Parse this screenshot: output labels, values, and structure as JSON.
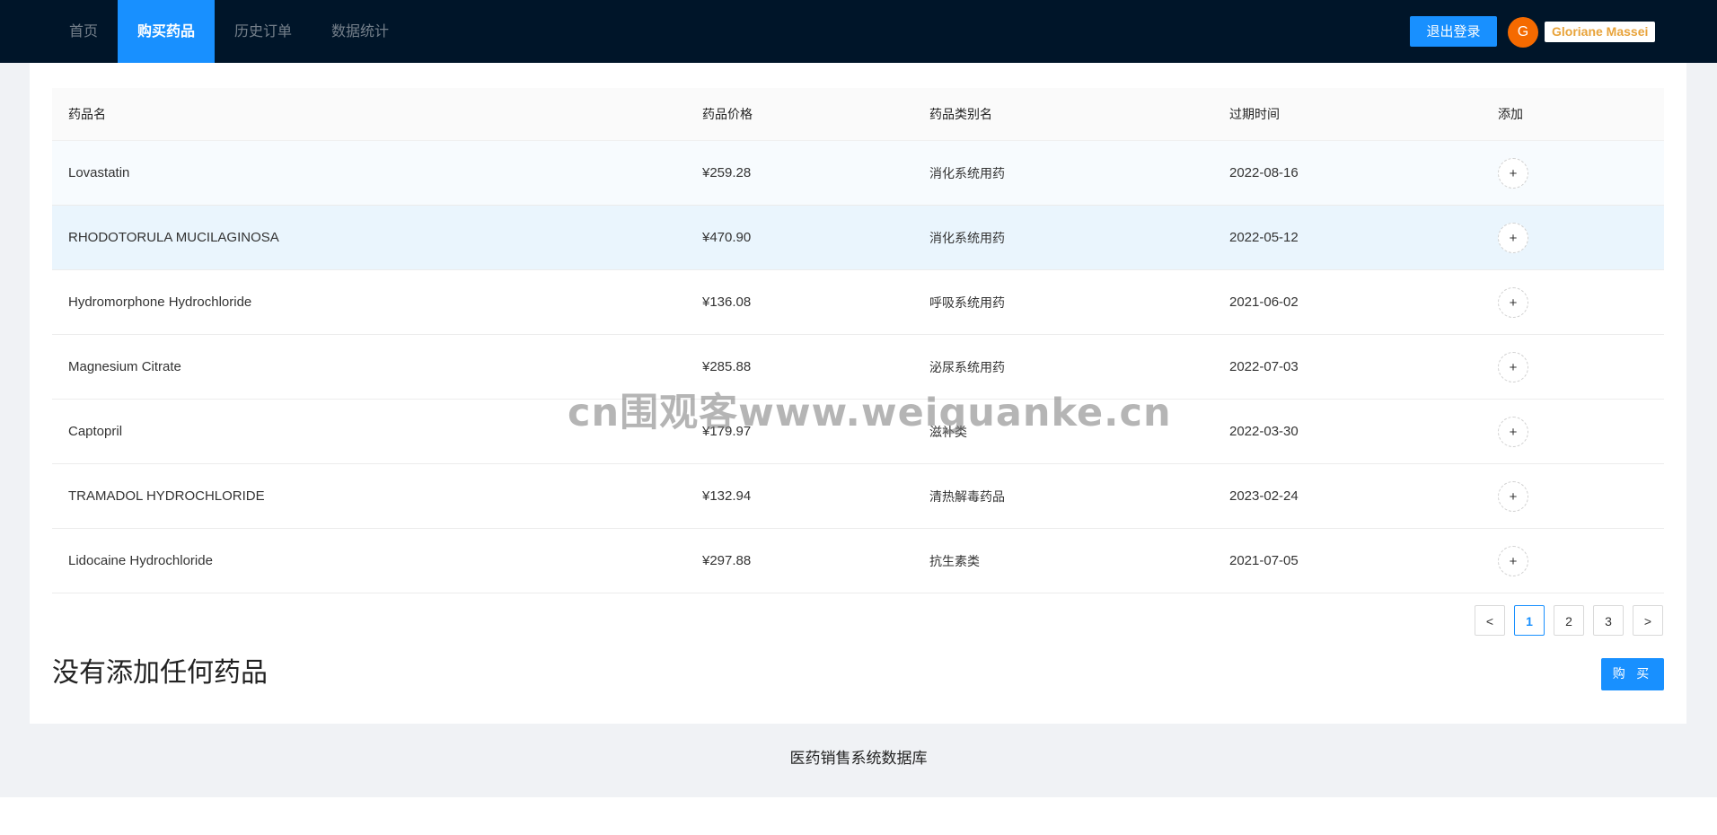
{
  "nav": {
    "items": [
      {
        "label": "首页"
      },
      {
        "label": "购买药品"
      },
      {
        "label": "历史订单"
      },
      {
        "label": "数据统计"
      }
    ],
    "active_index": 1
  },
  "header": {
    "logout_label": "退出登录",
    "avatar_initial": "G",
    "username": "Gloriane Massei"
  },
  "table": {
    "headers": [
      "药品名",
      "药品价格",
      "药品类别名",
      "过期时间",
      "添加"
    ],
    "rows": [
      {
        "name": "Lovastatin",
        "price": "¥259.28",
        "category": "消化系统用药",
        "expiry": "2022-08-16",
        "add": "+"
      },
      {
        "name": "RHODOTORULA MUCILAGINOSA",
        "price": "¥470.90",
        "category": "消化系统用药",
        "expiry": "2022-05-12",
        "add": "+"
      },
      {
        "name": "Hydromorphone Hydrochloride",
        "price": "¥136.08",
        "category": "呼吸系统用药",
        "expiry": "2021-06-02",
        "add": "+"
      },
      {
        "name": "Magnesium Citrate",
        "price": "¥285.88",
        "category": "泌尿系统用药",
        "expiry": "2022-07-03",
        "add": "+"
      },
      {
        "name": "Captopril",
        "price": "¥179.97",
        "category": "滋补类",
        "expiry": "2022-03-30",
        "add": "+"
      },
      {
        "name": "TRAMADOL HYDROCHLORIDE",
        "price": "¥132.94",
        "category": "清热解毒药品",
        "expiry": "2023-02-24",
        "add": "+"
      },
      {
        "name": "Lidocaine Hydrochloride",
        "price": "¥297.88",
        "category": "抗生素类",
        "expiry": "2021-07-05",
        "add": "+"
      }
    ]
  },
  "pagination": {
    "prev": "<",
    "pages": [
      "1",
      "2",
      "3"
    ],
    "current": "1",
    "next": ">"
  },
  "cart": {
    "empty_message": "没有添加任何药品",
    "buy_label": "购 买"
  },
  "footer": {
    "text": "医药销售系统数据库"
  },
  "watermark": {
    "text": "cn围观客www.weiguanke.cn"
  },
  "colors": {
    "header_bg": "#001529",
    "accent": "#1890ff",
    "avatar_bg": "#f56a00",
    "username_text": "#e8a33a"
  }
}
